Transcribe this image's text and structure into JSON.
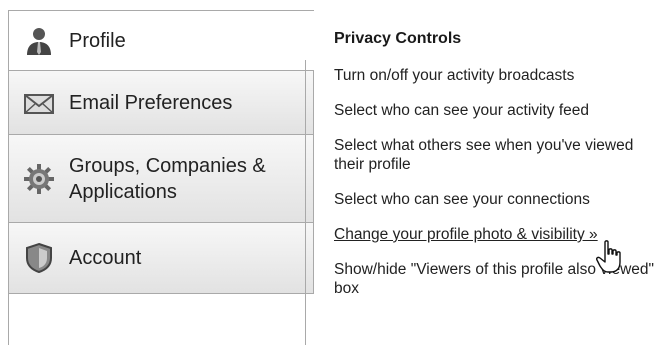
{
  "nav": {
    "items": [
      {
        "label": "Profile",
        "icon": "user-icon"
      },
      {
        "label": "Email Preferences",
        "icon": "envelope-icon"
      },
      {
        "label_line1": "Groups, Companies &",
        "label_line2": "Applications",
        "icon": "gear-icon"
      },
      {
        "label": "Account",
        "icon": "shield-icon"
      }
    ]
  },
  "panel": {
    "title": "Privacy Controls",
    "links": [
      "Turn on/off your activity broadcasts",
      "Select who can see your activity feed",
      "Select what others see when you've viewed their profile",
      "Select who can see your connections",
      "Change your profile photo & visibility »",
      "Show/hide \"Viewers of this profile also viewed\" box"
    ]
  }
}
